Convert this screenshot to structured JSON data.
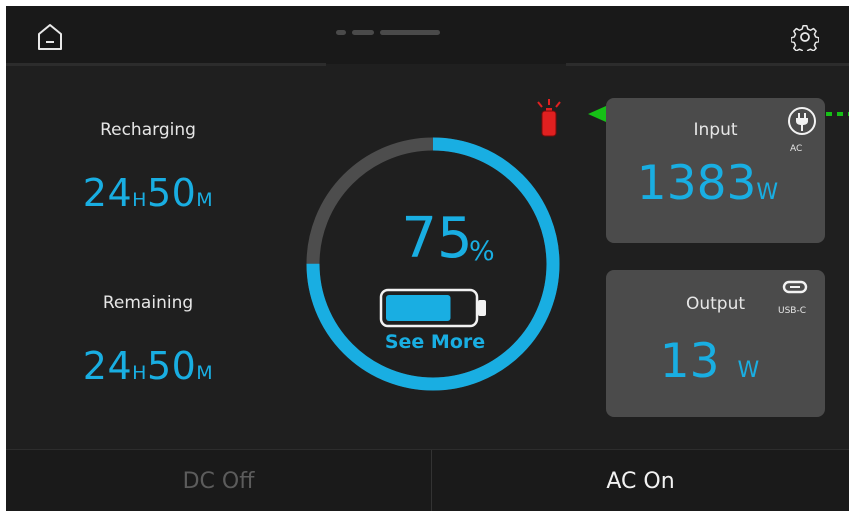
{
  "header": {
    "home_icon": "home-icon",
    "settings_icon": "gear-icon"
  },
  "recharging": {
    "label": "Recharging",
    "hours": "24",
    "hours_unit": "H",
    "minutes": "50",
    "minutes_unit": "M"
  },
  "remaining": {
    "label": "Remaining",
    "hours": "24",
    "hours_unit": "H",
    "minutes": "50",
    "minutes_unit": "M"
  },
  "battery": {
    "percent_value": "75",
    "percent_unit": "%",
    "level": 0.75,
    "see_more": "See More"
  },
  "input": {
    "title": "Input",
    "value": "1383",
    "unit": "W",
    "source": "AC",
    "icon": "plug-icon"
  },
  "output": {
    "title": "Output",
    "value": "13",
    "unit": "W",
    "port": "USB-C",
    "icon": "usb-c-icon"
  },
  "alert": {
    "icon": "battery-alert-icon",
    "color": "#e02020",
    "arrow_color": "#16c016"
  },
  "buttons": {
    "dc": "DC Off",
    "ac": "AC On"
  },
  "colors": {
    "accent": "#19aee2",
    "background": "#1f1f1f",
    "card": "#4b4b4b"
  }
}
